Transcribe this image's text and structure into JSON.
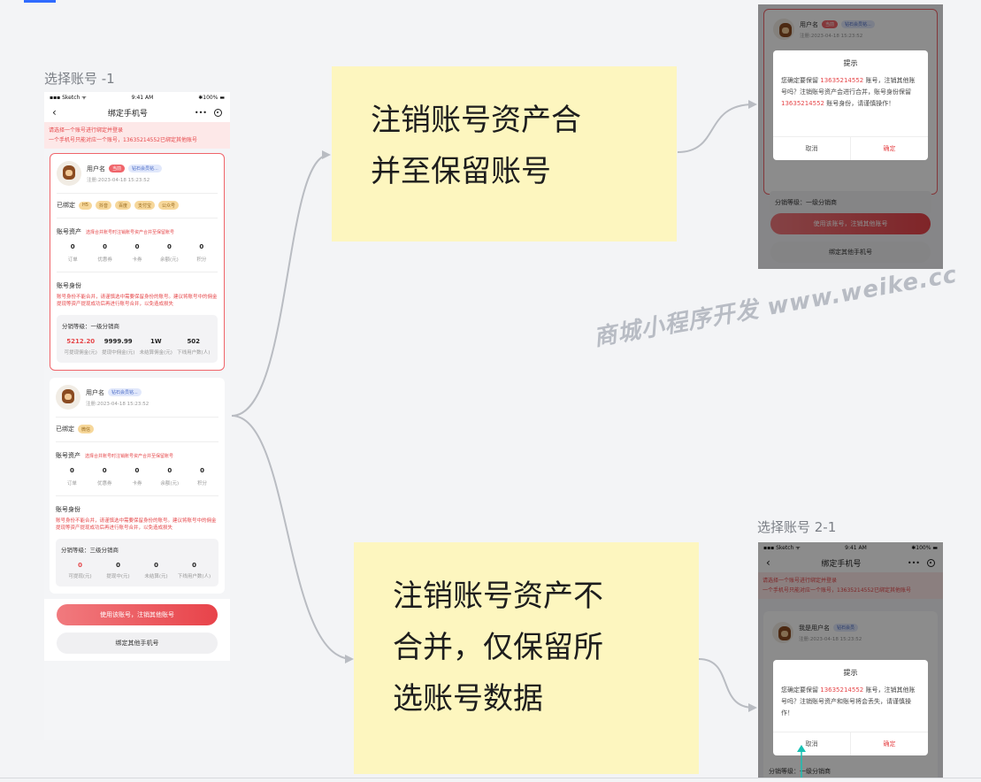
{
  "frames": {
    "left_title": "选择账号 -1",
    "right_title": "选择账号 2-1"
  },
  "phone": {
    "status_carrier": "Sketch",
    "status_time": "9:41 AM",
    "status_battery": "100%",
    "nav_title": "绑定手机号",
    "nav_more": "•••",
    "notice_line1": "请选择一个账号进行绑定并登录",
    "notice_line2": "一个手机号只能对应一个账号，13635214552已绑定其他账号"
  },
  "account1": {
    "user_name": "用户名",
    "tag_primary": "当前",
    "tag_level": "钻石会员铭...",
    "date": "注册:2023-04-18 15:23:52",
    "bound_label": "已绑定",
    "bound_chips": [
      "H5",
      "抖音",
      "百度",
      "支付宝",
      "公众号"
    ],
    "assets_title": "账号资产",
    "assets_note": "选择合并账号时注销账号资产合并至保留账号",
    "stats": [
      {
        "num": "0",
        "label": "订单"
      },
      {
        "num": "0",
        "label": "优惠券"
      },
      {
        "num": "0",
        "label": "卡券"
      },
      {
        "num": "0",
        "label": "余额(元)"
      },
      {
        "num": "0",
        "label": "积分"
      }
    ],
    "identity_title": "账号身份",
    "identity_warn": "账号身份不能合并，请谨慎选中需要保留身份的账号。建议将账号中的佣金提现等资产提现成功后再进行账号合并，以免造成损失",
    "dist_level": "分销等级：一级分销商",
    "dist_stats": [
      {
        "num": "5212.20",
        "label": "可提现佣金(元)"
      },
      {
        "num": "9999.99",
        "label": "提现中佣金(元)"
      },
      {
        "num": "1W",
        "label": "未结算佣金(元)"
      },
      {
        "num": "502",
        "label": "下线用户数(人)"
      }
    ]
  },
  "account2": {
    "user_name": "用户名",
    "tag_level": "钻石会员铭...",
    "date": "注册:2023-04-18 15:23:52",
    "bound_label": "已绑定",
    "bound_chips": [
      "微信"
    ],
    "assets_title": "账号资产",
    "assets_note": "选择合并账号时注销账号资产合并至保留账号",
    "stats": [
      {
        "num": "0",
        "label": "订单"
      },
      {
        "num": "0",
        "label": "优惠券"
      },
      {
        "num": "0",
        "label": "卡券"
      },
      {
        "num": "0",
        "label": "余额(元)"
      },
      {
        "num": "0",
        "label": "积分"
      }
    ],
    "identity_title": "账号身份",
    "identity_warn": "账号身份不能合并，请谨慎选中需要保留身份的账号。建议将账号中的佣金提现等资产提现成功后再进行账号合并，以免造成损失",
    "dist_level": "分销等级：三级分销商",
    "dist_stats": [
      {
        "num": "0",
        "label": "可提现(元)"
      },
      {
        "num": "0",
        "label": "提现中(元)"
      },
      {
        "num": "0",
        "label": "未结算(元)"
      },
      {
        "num": "0",
        "label": "下线用户数(人)"
      }
    ]
  },
  "buttons": {
    "primary": "使用该账号，注销其他账号",
    "secondary": "绑定其他手机号"
  },
  "notes": {
    "merge_line1": "注销账号资产合",
    "merge_line2": "并至保留账号",
    "nomerge_line1": "注销账号资产不",
    "nomerge_line2": "合并，仅保留所",
    "nomerge_line3": "选账号数据"
  },
  "watermark": "商城小程序开发 www.weike.cc",
  "dialog1": {
    "title": "提示",
    "body_a": "您确定要保留 ",
    "phone": "13635214552",
    "body_b": " 账号，注销其他账号吗？注销账号资产会进行合并，账号身份保留 ",
    "phone2": "13635214552",
    "body_c": " 账号身份，请谨慎操作！",
    "cancel": "取消",
    "ok": "确定",
    "bg_user": "用户名",
    "bg_tag": "当前",
    "bg_level": "钻石会员铭...",
    "bg_date": "注册:2023-04-18 15:23:52",
    "bg_dist": "分销等级：一级分销商",
    "bg_primary": "使用该账号，注销其他账号",
    "bg_secondary": "绑定其他手机号"
  },
  "dialog2": {
    "title": "提示",
    "body_a": "您确定要保留 ",
    "phone": "13635214552",
    "body_b": " 账号，注销其他账号吗？注销账号资产和账号将会丢失，请谨慎操作！",
    "cancel": "取消",
    "ok": "确定",
    "bg_user": "我是用户名",
    "bg_level": "钻石会员",
    "bg_date": "注册:2023-04-18 15:23:52",
    "bg_dist": "分销等级：一级分销商"
  }
}
